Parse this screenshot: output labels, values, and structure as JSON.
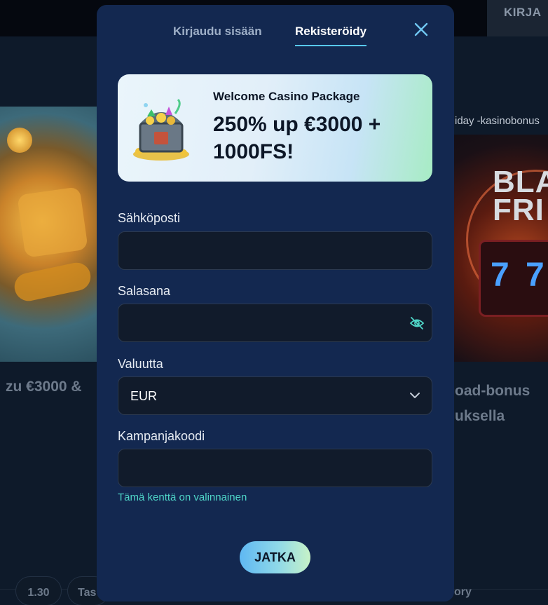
{
  "background": {
    "topbar_login_label": "KIRJA",
    "right_card_tag": "iday -kasinobonus",
    "right_card_title": "BLA\nFRI",
    "right_card_slot": "7 7",
    "left_card_text": "zu €3000 &",
    "right_card_text_line1": "oad-bonus",
    "right_card_text_line2": "uksella",
    "bottom_pills": [
      "1.30",
      "Tas",
      "ory"
    ]
  },
  "modal": {
    "tabs": {
      "login": "Kirjaudu sisään",
      "register": "Rekisteröidy",
      "active": "register"
    },
    "promo": {
      "eyebrow": "Welcome Casino Package",
      "headline": "250% up €3000 + 1000FS!"
    },
    "fields": {
      "email": {
        "label": "Sähköposti",
        "value": "",
        "placeholder": ""
      },
      "password": {
        "label": "Salasana",
        "value": "",
        "placeholder": ""
      },
      "currency": {
        "label": "Valuutta",
        "selected": "EUR"
      },
      "promo_code": {
        "label": "Kampanjakoodi",
        "value": "",
        "placeholder": "",
        "helper": "Tämä kenttä on valinnainen"
      }
    },
    "submit_label": "JATKA"
  },
  "colors": {
    "modal_bg": "#132850",
    "accent_tab_underline": "#58c9f0",
    "helper_text": "#4fd6c8",
    "input_bg": "#111b2b"
  },
  "icons": {
    "close": "close-icon",
    "password_toggle": "eye-off-icon",
    "dropdown": "chevron-down-icon",
    "promo": "treasure-chest-icon"
  }
}
